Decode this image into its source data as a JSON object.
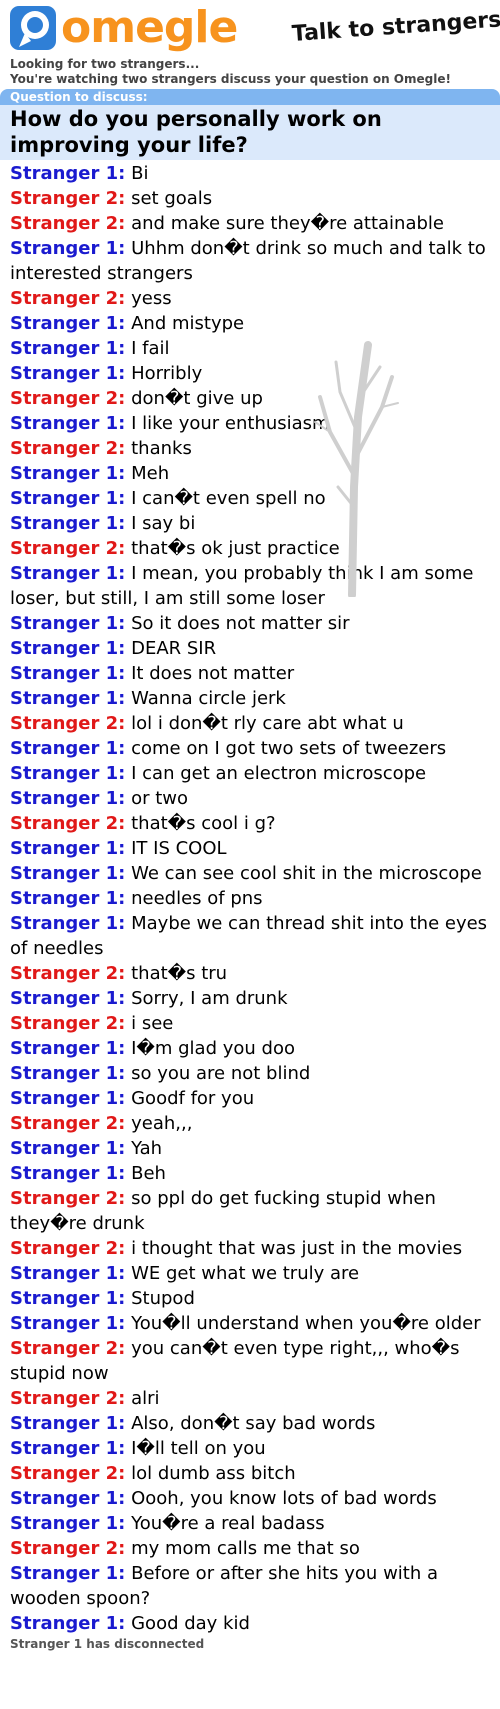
{
  "brand": {
    "name": "omegle",
    "tagline": "Talk to strangers!"
  },
  "status": {
    "line1": "Looking for two strangers...",
    "line2": "You're watching two strangers discuss your question on Omegle!"
  },
  "question": {
    "label": "Question to discuss:",
    "text": "How do you personally work on improving your life?"
  },
  "colors": {
    "stranger1": "#1a1acf",
    "stranger2": "#e01818",
    "brand": "#f7931e",
    "question_bg": "#dbe9fb",
    "question_label_bg": "#7fb5f0"
  },
  "messages": [
    {
      "who": "Stranger 1:",
      "role": "s1",
      "text": "Bi"
    },
    {
      "who": "Stranger 2:",
      "role": "s2",
      "text": "set goals"
    },
    {
      "who": "Stranger 2:",
      "role": "s2",
      "text": "and make sure they�re attainable"
    },
    {
      "who": "Stranger 1:",
      "role": "s1",
      "text": "Uhhm don�t drink so much and talk to interested strangers"
    },
    {
      "who": "Stranger 2:",
      "role": "s2",
      "text": "yess"
    },
    {
      "who": "Stranger 1:",
      "role": "s1",
      "text": "And mistype"
    },
    {
      "who": "Stranger 1:",
      "role": "s1",
      "text": "I fail"
    },
    {
      "who": "Stranger 1:",
      "role": "s1",
      "text": "Horribly"
    },
    {
      "who": "Stranger 2:",
      "role": "s2",
      "text": "don�t give up"
    },
    {
      "who": "Stranger 1:",
      "role": "s1",
      "text": "I like your enthusiasm"
    },
    {
      "who": "Stranger 2:",
      "role": "s2",
      "text": "thanks"
    },
    {
      "who": "Stranger 1:",
      "role": "s1",
      "text": "Meh"
    },
    {
      "who": "Stranger 1:",
      "role": "s1",
      "text": "I can�t even spell no"
    },
    {
      "who": "Stranger 1:",
      "role": "s1",
      "text": "I say bi"
    },
    {
      "who": "Stranger 2:",
      "role": "s2",
      "text": "that�s ok just practice"
    },
    {
      "who": "Stranger 1:",
      "role": "s1",
      "text": "I mean, you probably think I am some loser, but still, I am still some loser"
    },
    {
      "who": "Stranger 1:",
      "role": "s1",
      "text": "So it does not matter sir"
    },
    {
      "who": "Stranger 1:",
      "role": "s1",
      "text": "DEAR SIR"
    },
    {
      "who": "Stranger 1:",
      "role": "s1",
      "text": "It does not matter"
    },
    {
      "who": "Stranger 1:",
      "role": "s1",
      "text": "Wanna circle jerk"
    },
    {
      "who": "Stranger 2:",
      "role": "s2",
      "text": "lol i don�t rly care abt what u"
    },
    {
      "who": "Stranger 1:",
      "role": "s1",
      "text": "come on I got two sets of tweezers"
    },
    {
      "who": "Stranger 1:",
      "role": "s1",
      "text": "I can get an electron microscope"
    },
    {
      "who": "Stranger 1:",
      "role": "s1",
      "text": "or two"
    },
    {
      "who": "Stranger 2:",
      "role": "s2",
      "text": "that�s cool i g?"
    },
    {
      "who": "Stranger 1:",
      "role": "s1",
      "text": "IT IS COOL"
    },
    {
      "who": "Stranger 1:",
      "role": "s1",
      "text": "We can see cool shit in the microscope"
    },
    {
      "who": "Stranger 1:",
      "role": "s1",
      "text": "needles of pns"
    },
    {
      "who": "Stranger 1:",
      "role": "s1",
      "text": "Maybe we can thread shit into the eyes of needles"
    },
    {
      "who": "Stranger 2:",
      "role": "s2",
      "text": "that�s tru"
    },
    {
      "who": "Stranger 1:",
      "role": "s1",
      "text": "Sorry, I am drunk"
    },
    {
      "who": "Stranger 2:",
      "role": "s2",
      "text": "i see"
    },
    {
      "who": "Stranger 1:",
      "role": "s1",
      "text": "I�m glad you doo"
    },
    {
      "who": "Stranger 1:",
      "role": "s1",
      "text": "so you are not blind"
    },
    {
      "who": "Stranger 1:",
      "role": "s1",
      "text": "Goodf for you"
    },
    {
      "who": "Stranger 2:",
      "role": "s2",
      "text": "yeah,,,"
    },
    {
      "who": "Stranger 1:",
      "role": "s1",
      "text": "Yah"
    },
    {
      "who": "Stranger 1:",
      "role": "s1",
      "text": "Beh"
    },
    {
      "who": "Stranger 2:",
      "role": "s2",
      "text": "so ppl do get fucking stupid when they�re drunk"
    },
    {
      "who": "Stranger 2:",
      "role": "s2",
      "text": "i thought that was just in the movies"
    },
    {
      "who": "Stranger 1:",
      "role": "s1",
      "text": "WE get what we truly are"
    },
    {
      "who": "Stranger 1:",
      "role": "s1",
      "text": "Stupod"
    },
    {
      "who": "Stranger 1:",
      "role": "s1",
      "text": "You�ll understand when you�re older"
    },
    {
      "who": "Stranger 2:",
      "role": "s2",
      "text": "you can�t even type right,,, who�s stupid now"
    },
    {
      "who": "Stranger 2:",
      "role": "s2",
      "text": "alri"
    },
    {
      "who": "Stranger 1:",
      "role": "s1",
      "text": "Also, don�t say bad words"
    },
    {
      "who": "Stranger 1:",
      "role": "s1",
      "text": "I�ll tell on you"
    },
    {
      "who": "Stranger 2:",
      "role": "s2",
      "text": "lol dumb ass bitch"
    },
    {
      "who": "Stranger 1:",
      "role": "s1",
      "text": "Oooh, you know lots of bad words"
    },
    {
      "who": "Stranger 1:",
      "role": "s1",
      "text": "You�re a real badass"
    },
    {
      "who": "Stranger 2:",
      "role": "s2",
      "text": "my mom calls me that so"
    },
    {
      "who": "Stranger 1:",
      "role": "s1",
      "text": "Before or after she hits you with a wooden spoon?"
    },
    {
      "who": "Stranger 1:",
      "role": "s1",
      "text": "Good day kid"
    }
  ],
  "footer": {
    "disconnect": "Stranger 1 has disconnected"
  }
}
